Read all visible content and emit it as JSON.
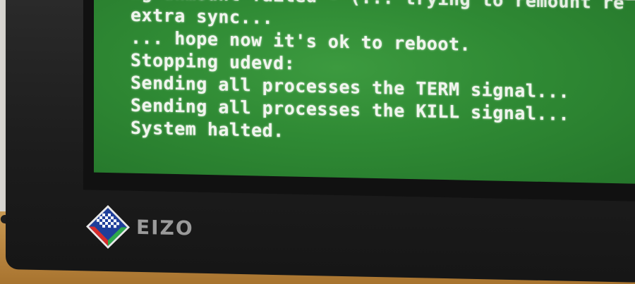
{
  "terminal": {
    "lines": [
      "ng unmount failed - (... trying to remount re",
      "extra sync...",
      "... hope now it's ok to reboot.",
      "Stopping udevd:",
      "Sending all processes the TERM signal...",
      "Sending all processes the KILL signal...",
      "System halted."
    ]
  },
  "monitor": {
    "brand": "EIZO",
    "logo_icon": "eizo-checkered-diamond-logo"
  },
  "colors": {
    "screen_green": "#2f8a34",
    "terminal_text": "#f1f5ee",
    "bezel": "#1c1c1c",
    "desk": "#b8843f"
  }
}
